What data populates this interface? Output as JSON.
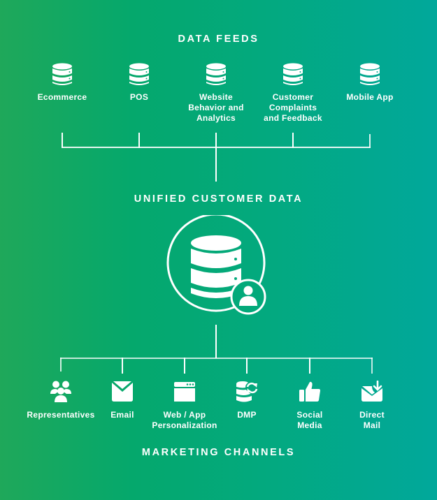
{
  "colors": {
    "gradient_start": "#1fa85a",
    "gradient_mid": "#03a97e",
    "gradient_end": "#01a89b",
    "foreground": "#ffffff"
  },
  "data_feeds": {
    "title": "DATA FEEDS",
    "items": [
      {
        "label": "Ecommerce",
        "icon": "database-icon"
      },
      {
        "label": "POS",
        "icon": "database-icon"
      },
      {
        "label": "Website\nBehavior and\nAnalytics",
        "icon": "database-icon"
      },
      {
        "label": "Customer\nComplaints\nand Feedback",
        "icon": "database-icon"
      },
      {
        "label": "Mobile App",
        "icon": "database-icon"
      }
    ]
  },
  "hub": {
    "title": "UNIFIED CUSTOMER DATA",
    "icon": "database-user-icon"
  },
  "marketing_channels": {
    "title": "MARKETING CHANNELS",
    "items": [
      {
        "label": "Representatives",
        "icon": "people-group-icon"
      },
      {
        "label": "Email",
        "icon": "envelope-icon"
      },
      {
        "label": "Web / App\nPersonalization",
        "icon": "browser-window-icon"
      },
      {
        "label": "DMP",
        "icon": "database-sync-icon"
      },
      {
        "label": "Social\nMedia",
        "icon": "thumbs-up-icon"
      },
      {
        "label": "Direct\nMail",
        "icon": "mail-download-icon"
      }
    ]
  }
}
